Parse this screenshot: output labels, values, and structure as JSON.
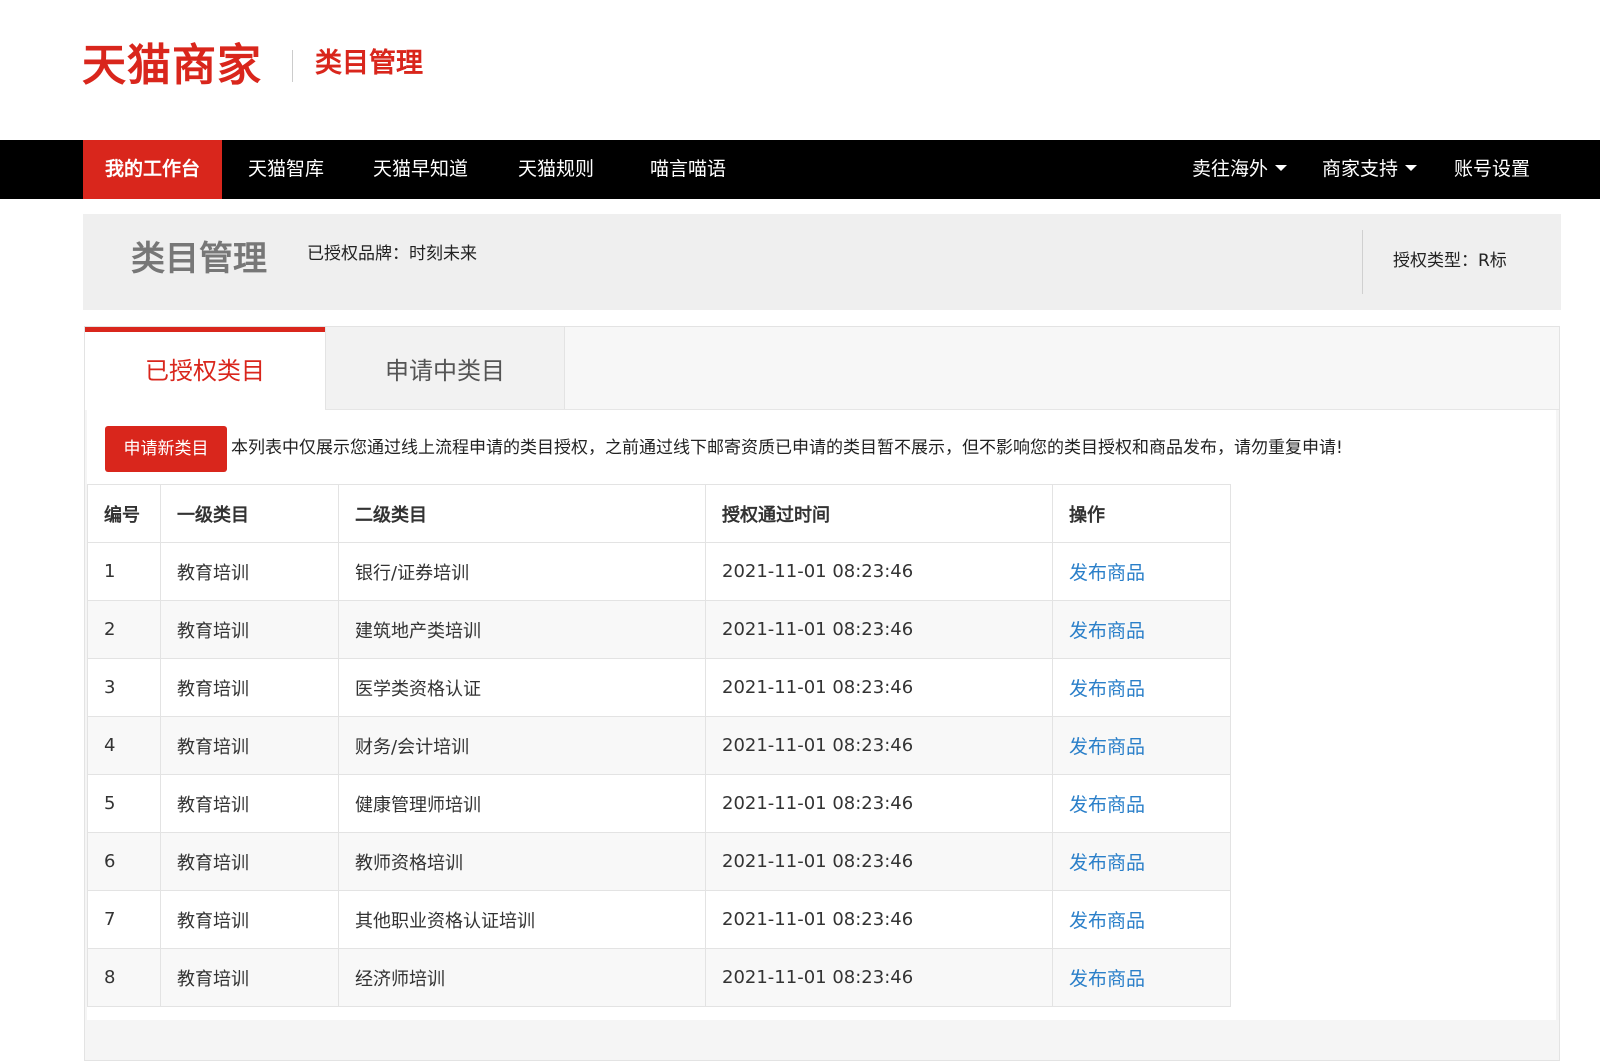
{
  "header": {
    "logo_text": "天猫商家",
    "subtitle": "类目管理"
  },
  "nav": {
    "items": [
      {
        "label": "我的工作台",
        "active": true
      },
      {
        "label": "天猫智库"
      },
      {
        "label": "天猫早知道"
      },
      {
        "label": "天猫规则"
      },
      {
        "label": "喵言喵语"
      }
    ],
    "right_items": [
      {
        "label": "卖往海外",
        "dropdown": true
      },
      {
        "label": "商家支持",
        "dropdown": true
      },
      {
        "label": "账号设置"
      }
    ]
  },
  "title_bar": {
    "title": "类目管理",
    "brand_info": "已授权品牌：时刻未来",
    "auth_type": "授权类型：R标"
  },
  "tabs": [
    {
      "label": "已授权类目",
      "active": true
    },
    {
      "label": "申请中类目"
    }
  ],
  "toolbar": {
    "apply_button": "申请新类目",
    "notice": "本列表中仅展示您通过线上流程申请的类目授权，之前通过线下邮寄资质已申请的类目暂不展示，但不影响您的类目授权和商品发布，请勿重复申请!"
  },
  "table": {
    "headers": [
      "编号",
      "一级类目",
      "二级类目",
      "授权通过时间",
      "操作"
    ],
    "rows": [
      {
        "no": "1",
        "l1": "教育培训",
        "l2": "银行/证券培训",
        "time": "2021-11-01 08:23:46",
        "action": "发布商品"
      },
      {
        "no": "2",
        "l1": "教育培训",
        "l2": "建筑地产类培训",
        "time": "2021-11-01 08:23:46",
        "action": "发布商品"
      },
      {
        "no": "3",
        "l1": "教育培训",
        "l2": "医学类资格认证",
        "time": "2021-11-01 08:23:46",
        "action": "发布商品"
      },
      {
        "no": "4",
        "l1": "教育培训",
        "l2": "财务/会计培训",
        "time": "2021-11-01 08:23:46",
        "action": "发布商品"
      },
      {
        "no": "5",
        "l1": "教育培训",
        "l2": "健康管理师培训",
        "time": "2021-11-01 08:23:46",
        "action": "发布商品"
      },
      {
        "no": "6",
        "l1": "教育培训",
        "l2": "教师资格培训",
        "time": "2021-11-01 08:23:46",
        "action": "发布商品"
      },
      {
        "no": "7",
        "l1": "教育培训",
        "l2": "其他职业资格认证培训",
        "time": "2021-11-01 08:23:46",
        "action": "发布商品"
      },
      {
        "no": "8",
        "l1": "教育培训",
        "l2": "经济师培训",
        "time": "2021-11-01 08:23:46",
        "action": "发布商品"
      }
    ]
  },
  "colors": {
    "brand_red": "#d9261c",
    "nav_bg": "#000000",
    "link_blue": "#2a7fc9"
  }
}
